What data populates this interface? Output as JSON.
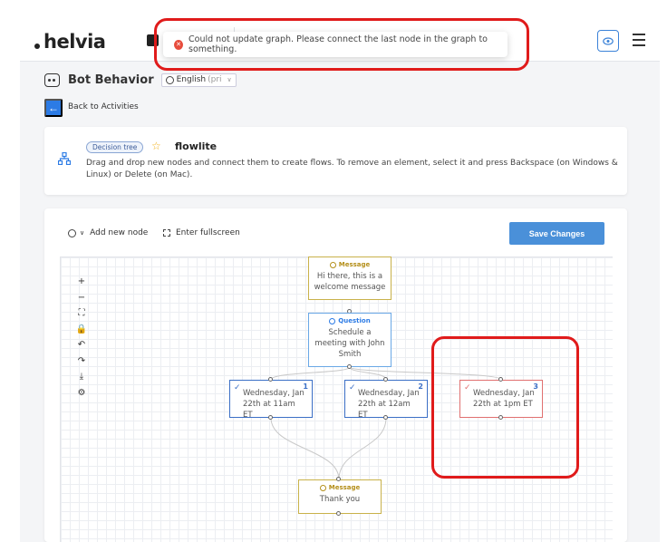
{
  "app": {
    "logo_text": "helvia"
  },
  "toast": {
    "message": "Could not update graph. Please connect the last node in the graph to something."
  },
  "header": {
    "bot_title": "Bot Behavior",
    "language_value": "English",
    "language_suffix": "(pri",
    "back_label": "Back to Activities"
  },
  "info_card": {
    "badge": "Decision tree",
    "flow_name": "flowlite",
    "description": "Drag and drop new nodes and connect them to create flows. To remove an element, select it and press Backspace (on Windows & Linux) or Delete (on Mac)."
  },
  "canvas_toolbar": {
    "add_node_label": "Add new node",
    "fullscreen_label": "Enter fullscreen",
    "save_label": "Save Changes"
  },
  "tools": [
    {
      "name": "zoom-in-icon",
      "glyph": "+"
    },
    {
      "name": "zoom-out-icon",
      "glyph": "−"
    },
    {
      "name": "fit-view-icon",
      "glyph": "⛶"
    },
    {
      "name": "lock-icon",
      "glyph": "🔒"
    },
    {
      "name": "undo-icon",
      "glyph": "↶"
    },
    {
      "name": "redo-icon",
      "glyph": "↷"
    },
    {
      "name": "download-icon",
      "glyph": "⤓"
    },
    {
      "name": "settings-icon",
      "glyph": "⚙"
    }
  ],
  "nodes": {
    "welcome": {
      "type": "Message",
      "text": "Hi there, this is a welcome message"
    },
    "question": {
      "type": "Question",
      "text": "Schedule a meeting with John Smith"
    },
    "option1": {
      "number": "1",
      "text": "Wednesday, Jan 22th at 11am ET"
    },
    "option2": {
      "number": "2",
      "text": "Wednesday, Jan 22th at 12am ET"
    },
    "option3": {
      "number": "3",
      "text": "Wednesday, Jan 22th at 1pm ET"
    },
    "thanks": {
      "type": "Message",
      "text": "Thank you"
    }
  },
  "colors": {
    "accent": "#2c7be5",
    "save_button": "#4a90d9",
    "error": "#e74c3c",
    "highlight_ring": "#e01b1b",
    "message_node": "#c9b24a",
    "question_node": "#6aa8e6",
    "option_node": "#3b6fc6",
    "error_node": "#e07070"
  }
}
